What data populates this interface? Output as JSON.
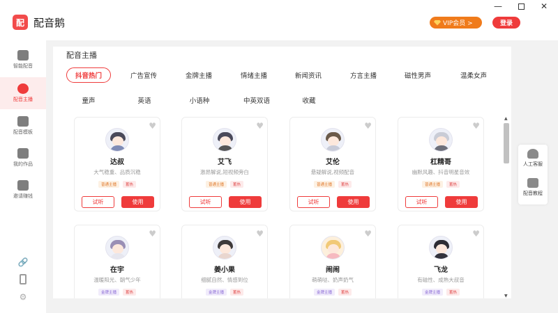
{
  "app": {
    "name": "配音鹅",
    "logo_text": "配"
  },
  "header": {
    "vip_label": "VIP会员 >",
    "login_label": "登录"
  },
  "sidebar": {
    "items": [
      {
        "label": "智能配音",
        "icon": "speaker-icon"
      },
      {
        "label": "配音主播",
        "icon": "anchor-icon"
      },
      {
        "label": "配音模板",
        "icon": "template-icon"
      },
      {
        "label": "我的作品",
        "icon": "folder-icon"
      },
      {
        "label": "邀请赚钱",
        "icon": "money-bag-icon"
      }
    ],
    "active_index": 1
  },
  "main": {
    "title": "配音主播",
    "tabs": [
      "抖音热门",
      "广告宣传",
      "金牌主播",
      "情绪主播",
      "新闻资讯",
      "方言主播",
      "磁性男声",
      "温柔女声",
      "童声",
      "英语",
      "小语种",
      "中英双语",
      "收藏"
    ],
    "active_tab": 0,
    "cards": [
      {
        "name": "达叔",
        "desc": "大气稳重、品质沉稳",
        "tag1": "普通主播",
        "tag2": "蓄热"
      },
      {
        "name": "艾飞",
        "desc": "激昂解说,短视频旁白",
        "tag1": "普通主播",
        "tag2": "蓄热"
      },
      {
        "name": "艾伦",
        "desc": "悬疑解说,视频配音",
        "tag1": "普通主播",
        "tag2": "蓄热"
      },
      {
        "name": "杠精哥",
        "desc": "幽默风趣、抖音明星音效",
        "tag1": "普通主播",
        "tag2": "蓄热"
      },
      {
        "name": "在宇",
        "desc": "温暖阳光、朝气少年",
        "tag1": "金牌主播",
        "tag2": "蓄热"
      },
      {
        "name": "姜小果",
        "desc": "细腻自然、情感到位",
        "tag1": "金牌主播",
        "tag2": "蓄热"
      },
      {
        "name": "闹闹",
        "desc": "萌萌哒、奶声奶气",
        "tag1": "金牌主播",
        "tag2": "蓄热"
      },
      {
        "name": "飞龙",
        "desc": "有磁性、成熟大叔音",
        "tag1": "金牌主播",
        "tag2": "蓄热"
      }
    ],
    "listen_label": "试听",
    "use_label": "使用"
  },
  "float_panel": {
    "items": [
      {
        "label": "人工客服",
        "icon": "headset-icon"
      },
      {
        "label": "配音教程",
        "icon": "book-icon"
      }
    ]
  },
  "colors": {
    "accent": "#ef3b3b",
    "vip": "#f07b1b"
  }
}
